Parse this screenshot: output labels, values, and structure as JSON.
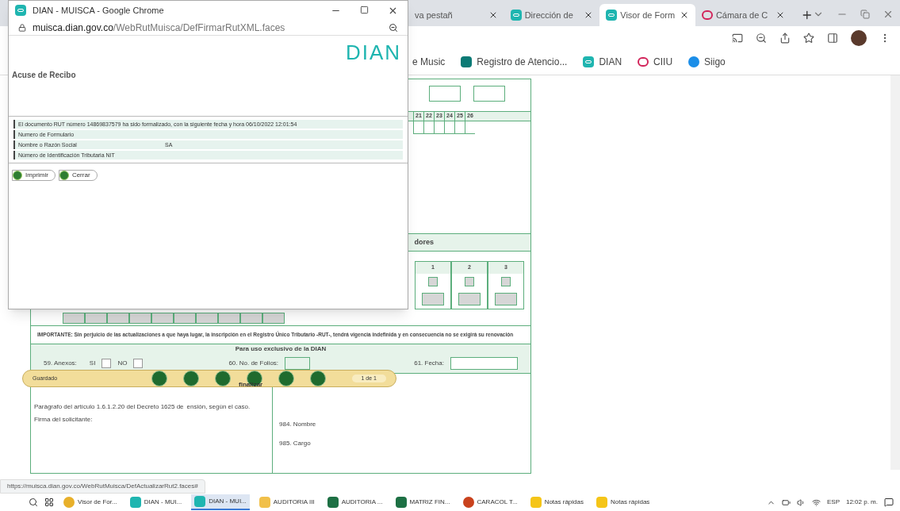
{
  "browser": {
    "tabs": [
      {
        "label": "va pestañ",
        "kind": "none",
        "selected": false
      },
      {
        "label": "Dirección de",
        "kind": "dian",
        "selected": false
      },
      {
        "label": "Visor de Form",
        "kind": "dian",
        "selected": true
      },
      {
        "label": "Cámara de C",
        "kind": "camara",
        "selected": false
      }
    ],
    "bookmarks": [
      {
        "label": "e Music",
        "kind": "none"
      },
      {
        "label": "Registro de Atencio...",
        "kind": "form"
      },
      {
        "label": "DIAN",
        "kind": "dian"
      },
      {
        "label": "CIIU",
        "kind": "camara"
      },
      {
        "label": "Siigo",
        "kind": "siigo"
      }
    ],
    "status_url": "https://muisca.dian.gov.co/WebRutMuisca/DefActualizarRut2.faces#"
  },
  "form": {
    "number_headers": [
      "21",
      "22",
      "23",
      "24",
      "25",
      "26"
    ],
    "section_title": "dores",
    "column_headers": [
      "1",
      "2",
      "3"
    ],
    "notice": "IMPORTANTE:  Sin perjuicio de las actualizaciones a que haya lugar, la inscripción en el Registro Único Tributario -RUT-, tendrá vigencia indefinida y en consecuencia no se exigirá su renovación",
    "dian_title": "Para uso exclusivo de la DIAN",
    "annex_label": "59. Anexos:",
    "yes_label": "SI",
    "no_label": "NO",
    "annex_yes_checked": false,
    "annex_no_checked": false,
    "folios_label": "60. No. de Folios:",
    "date_label": "61. Fecha:",
    "paragraph": "Parágrafo del artículo 1.6.1.2.20 del Decreto 1625 de",
    "paragraph_tail": "ensión, según el caso.",
    "signature_label": "Firma del solicitante:",
    "name_label": "984. Nombre",
    "role_label": "985. Cargo"
  },
  "floating_toolbar": {
    "status": "Guardado",
    "finish_label": "finalizar",
    "page": "1 de 1"
  },
  "popup": {
    "title": "DIAN - MUISCA - Google Chrome",
    "url_host": "muisca.dian.gov.co",
    "url_path": "/WebRutMuisca/DefFirmarRutXML.faces",
    "logo": "DIAN",
    "heading": "Acuse de Recibo",
    "rows": [
      {
        "label": "El documento RUT número 14869837579 ha sido formalizado, con la siguiente fecha y hora 06/10/2022 12:01:54"
      },
      {
        "label": "Numero de Formulario"
      },
      {
        "label": "Nombre o Razón Social",
        "value": "SA"
      },
      {
        "label": "Número de Identificación Tributaria NIT"
      }
    ],
    "buttons": [
      "Imprimir",
      "Cerrar"
    ]
  },
  "taskbar": {
    "items": [
      {
        "label": "Visor de For...",
        "kind": "chrome",
        "selected": false
      },
      {
        "label": "DIAN - MUI...",
        "kind": "dian",
        "selected": false
      },
      {
        "label": "DIAN - MUI...",
        "kind": "dian",
        "selected": true
      },
      {
        "label": "AUDITORIA III",
        "kind": "folder",
        "selected": false
      },
      {
        "label": "AUDITORIA ...",
        "kind": "excel",
        "selected": false
      },
      {
        "label": "MATRIZ FIN...",
        "kind": "excel",
        "selected": false
      },
      {
        "label": "CARACOL T...",
        "kind": "ppt",
        "selected": false
      },
      {
        "label": "Notas rápidas",
        "kind": "notes",
        "selected": false
      },
      {
        "label": "Notas rápidas",
        "kind": "notes",
        "selected": false
      }
    ],
    "language": "ESP",
    "time": "12:02 p. m."
  }
}
